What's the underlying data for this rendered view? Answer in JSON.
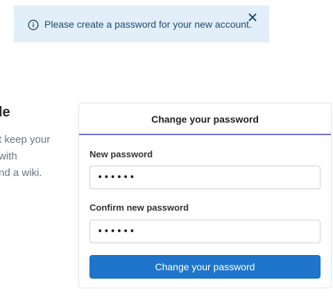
{
  "notice": {
    "icon": "info-circle-icon",
    "text": "Please create a password for your new account.",
    "close_icon": "close-icon",
    "color": "#1b4b72",
    "background": "#e2eef9"
  },
  "left": {
    "heading": "le",
    "lines": [
      "t keep your",
      "with",
      "nd a wiki."
    ]
  },
  "form": {
    "title": "Change your password",
    "new_password_label": "New password",
    "new_password_value": "••••••",
    "confirm_password_label": "Confirm new password",
    "confirm_password_value": "••••••",
    "submit_label": "Change your password",
    "accent_color": "#6b6fd4",
    "button_color": "#1f75cb"
  }
}
